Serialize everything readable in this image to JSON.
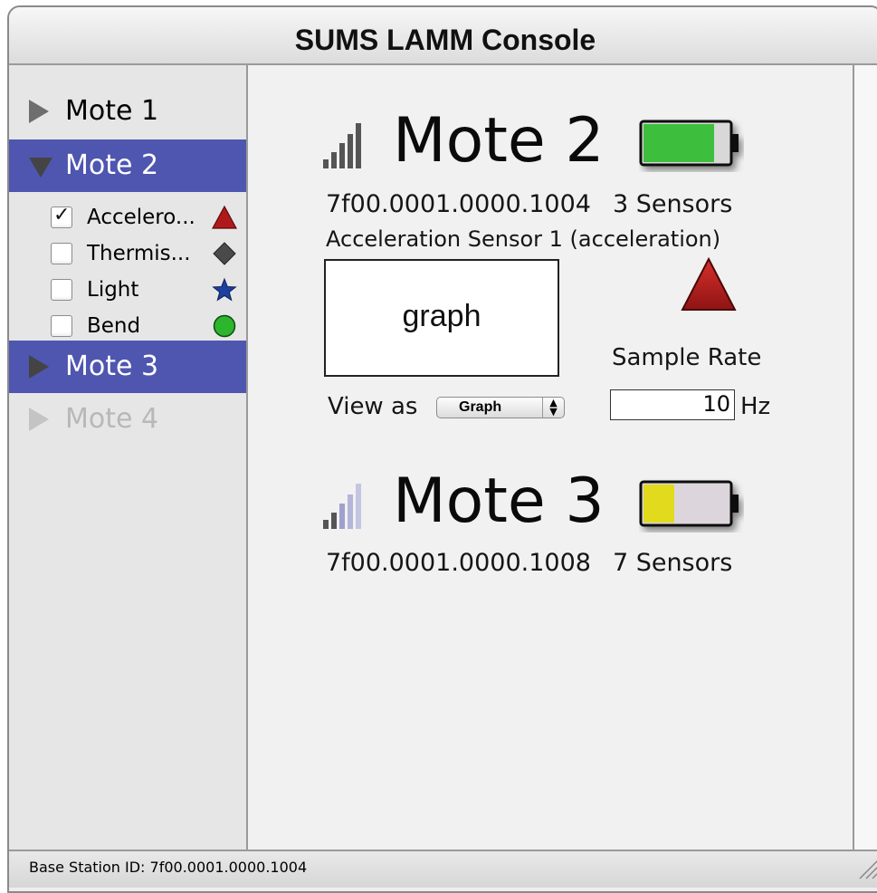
{
  "window": {
    "title": "SUMS LAMM Console"
  },
  "sidebar": {
    "motes": [
      {
        "label": "Mote 1",
        "state": "collapsed"
      },
      {
        "label": "Mote 2",
        "state": "expanded-selected"
      },
      {
        "label": "Mote 3",
        "state": "collapsed-selected"
      },
      {
        "label": "Mote 4",
        "state": "disabled"
      }
    ],
    "sensors": [
      {
        "label": "Accelero...",
        "checked": true,
        "icon": "red-triangle-icon",
        "color": "#b0191c"
      },
      {
        "label": "Thermis...",
        "checked": false,
        "icon": "gray-diamond-icon",
        "color": "#4a4a4a"
      },
      {
        "label": "Light",
        "checked": false,
        "icon": "blue-star-icon",
        "color": "#1c3fa0"
      },
      {
        "label": "Bend",
        "checked": false,
        "icon": "green-circle-icon",
        "color": "#2db52d"
      }
    ]
  },
  "main": {
    "mote2": {
      "title": "Mote 2",
      "id": "7f00.0001.0000.1004",
      "sensor_count": "3 Sensors",
      "battery_level": 0.85,
      "battery_color": "#3cbf3c",
      "signal_icon": "signal-strength-icon",
      "sensor_name": "Acceleration Sensor 1 (acceleration)",
      "graph_label": "graph",
      "sensor_icon": "red-triangle-icon",
      "sample_rate_label": "Sample Rate",
      "view_as_label": "View as",
      "view_as_value": "Graph",
      "sample_rate_value": "10",
      "sample_rate_unit": "Hz"
    },
    "mote3": {
      "title": "Mote 3",
      "id": "7f00.0001.0000.1008",
      "sensor_count": "7 Sensors",
      "battery_level": 0.35,
      "battery_color": "#e2da1e",
      "signal_icon": "signal-strength-icon"
    }
  },
  "statusbar": {
    "text": "Base Station ID: 7f00.0001.0000.1004"
  }
}
